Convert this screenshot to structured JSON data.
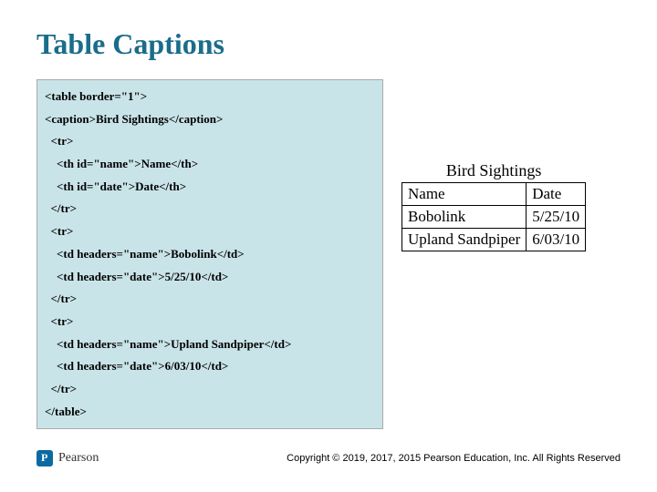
{
  "title": "Table Captions",
  "code_lines": [
    "<table border=\"1\">",
    "<caption>Bird Sightings</caption>",
    "  <tr>",
    "    <th id=\"name\">Name</th>",
    "    <th id=\"date\">Date</th>",
    "  </tr>",
    "  <tr>",
    "    <td headers=\"name\">Bobolink</td>",
    "    <td headers=\"date\">5/25/10</td>",
    "  </tr>",
    "  <tr>",
    "    <td headers=\"name\">Upland Sandpiper</td>",
    "    <td headers=\"date\">6/03/10</td>",
    "  </tr>",
    "</table>"
  ],
  "rendered": {
    "caption": "Bird Sightings",
    "headers": [
      "Name",
      "Date"
    ],
    "rows": [
      [
        "Bobolink",
        "5/25/10"
      ],
      [
        "Upland Sandpiper",
        "6/03/10"
      ]
    ]
  },
  "brand": "Pearson",
  "copyright": "Copyright © 2019, 2017, 2015 Pearson Education, Inc. All Rights Reserved"
}
